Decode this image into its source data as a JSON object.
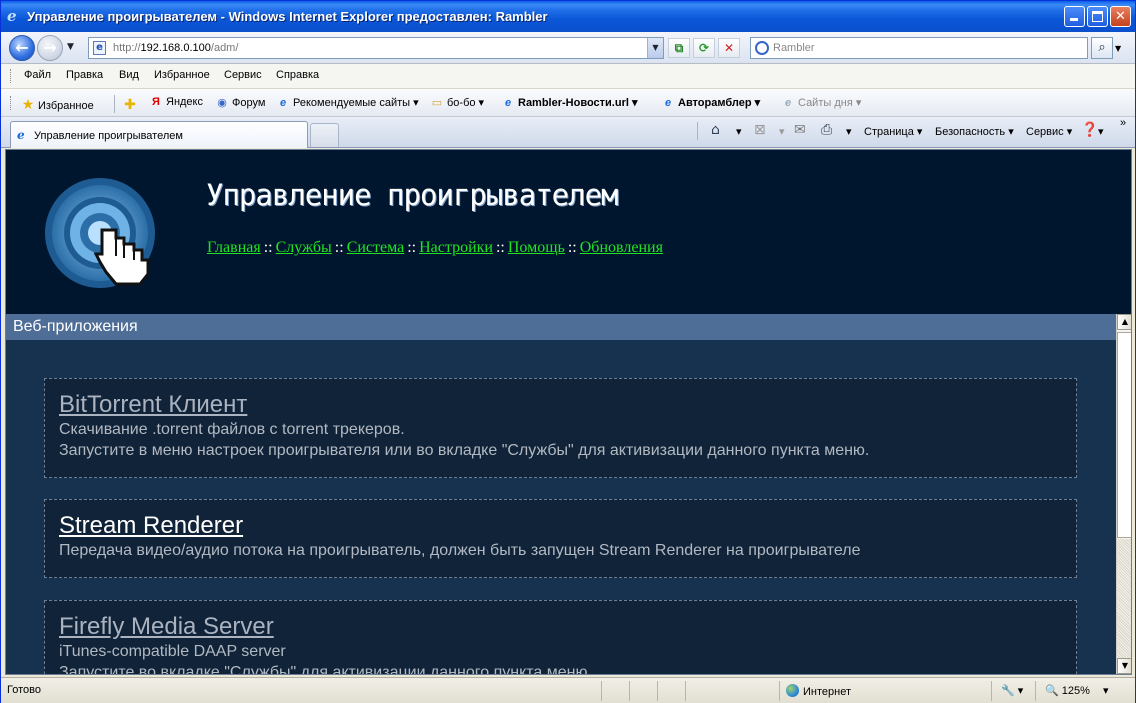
{
  "window": {
    "title": "Управление проигрывателем - Windows Internet Explorer предоставлен: Rambler"
  },
  "address": {
    "scheme": "http://",
    "host": "192.168.0.100",
    "path": "/adm/"
  },
  "search": {
    "placeholder": "Rambler"
  },
  "menu": [
    "Файл",
    "Правка",
    "Вид",
    "Избранное",
    "Сервис",
    "Справка"
  ],
  "favorites": {
    "label": "Избранное",
    "items": [
      "Яндекс",
      "Форум",
      "Рекомендуемые сайты",
      "бо-бо",
      "Rambler-Новости.url",
      "Авторамблер",
      "Сайты дня"
    ]
  },
  "tab": {
    "label": "Управление проигрывателем"
  },
  "commands": {
    "page": "Страница",
    "security": "Безопасность",
    "tools": "Сервис"
  },
  "site": {
    "title": "Управление проигрывателем",
    "nav": [
      "Главная",
      "Службы",
      "Система",
      "Настройки",
      "Помощь",
      "Обновления"
    ],
    "nav_separator": "::"
  },
  "section": {
    "title": "Веб-приложения"
  },
  "apps": [
    {
      "title": "BitTorrent Клиент",
      "lines": [
        "Скачивание .torrent файлов с torrent трекеров.",
        "Запустите в меню настроек проигрывателя или во вкладке \"Службы\" для активизации данного пункта меню."
      ]
    },
    {
      "title": "Stream Renderer",
      "lines": [
        "Передача видео/аудио потока на проигрыватель, должен быть запущен Stream Renderer на проигрывателе"
      ]
    },
    {
      "title": "Firefly Media Server",
      "lines": [
        "iTunes-compatible DAAP server",
        "Запустите во вкладке \"Службы\" для активизации данного пункта меню."
      ]
    }
  ],
  "status": {
    "text": "Готово",
    "zone": "Интернет",
    "zoom": "125%"
  },
  "colors": {
    "titlebar": "#0a56d8",
    "banner_bg": "#00162e",
    "content_bg": "#16324f",
    "section_bar": "#4f6e97",
    "nav_link": "#22e322"
  }
}
